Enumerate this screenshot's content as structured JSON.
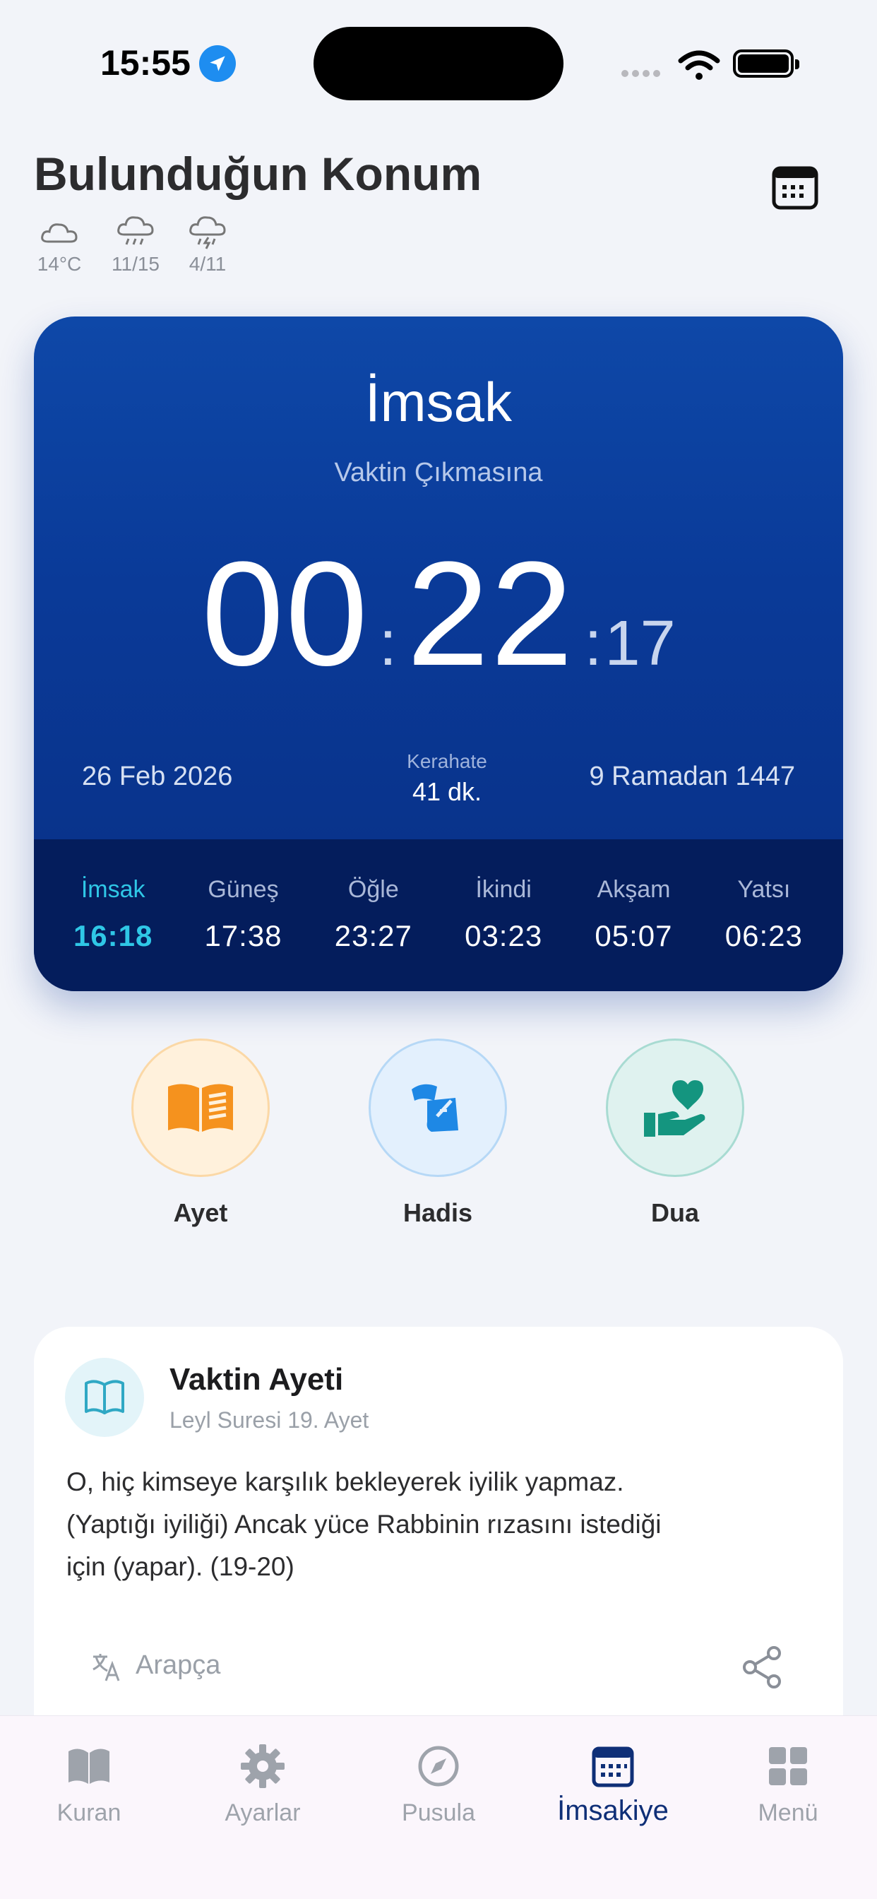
{
  "status_bar": {
    "time": "15:55"
  },
  "header": {
    "title": "Bulunduğun Konum",
    "weather": [
      {
        "icon": "cloud-icon",
        "label": "14°C"
      },
      {
        "icon": "rain-cloud-icon",
        "label": "11/15"
      },
      {
        "icon": "storm-cloud-icon",
        "label": "4/11"
      }
    ]
  },
  "prayer_card": {
    "current_name": "İmsak",
    "countdown_label": "Vaktin Çıkmasına",
    "countdown": {
      "hours": "00",
      "minutes": "22",
      "seconds": "17",
      "sep1": ":",
      "sep2": ":"
    },
    "date_gregorian": "26 Feb 2026",
    "kerahat_label": "Kerahate",
    "kerahat_value": "41 dk.",
    "date_hijri": "9 Ramadan 1447",
    "times": [
      {
        "name": "İmsak",
        "time": "16:18",
        "active": true
      },
      {
        "name": "Güneş",
        "time": "17:38"
      },
      {
        "name": "Öğle",
        "time": "23:27"
      },
      {
        "name": "İkindi",
        "time": "03:23"
      },
      {
        "name": "Akşam",
        "time": "05:07"
      },
      {
        "name": "Yatsı",
        "time": "06:23"
      }
    ],
    "accent_color": "#2fc7e6"
  },
  "quick_actions": [
    {
      "label": "Ayet",
      "icon": "open-book-icon",
      "color": "#f5921e"
    },
    {
      "label": "Hadis",
      "icon": "scroll-quill-icon",
      "color": "#1e88e5"
    },
    {
      "label": "Dua",
      "icon": "hand-heart-icon",
      "color": "#14957f"
    }
  ],
  "verse_card": {
    "title": "Vaktin Ayeti",
    "source": "Leyl Suresi 19. Ayet",
    "text_lines": [
      "O, hiç kimseye karşılık bekleyerek iyilik yapmaz.",
      "(Yaptığı iyiliği) Ancak yüce Rabbinin rızasını istediği",
      "için (yapar). (19-20)"
    ],
    "translate_label": "Arapça"
  },
  "tab_bar": {
    "tabs": [
      {
        "label": "Kuran",
        "icon": "book-icon"
      },
      {
        "label": "Ayarlar",
        "icon": "gear-icon"
      },
      {
        "label": "Pusula",
        "icon": "compass-icon"
      },
      {
        "label": "İmsakiye",
        "icon": "calendar-icon",
        "active": true
      },
      {
        "label": "Menü",
        "icon": "grid-icon"
      }
    ]
  }
}
